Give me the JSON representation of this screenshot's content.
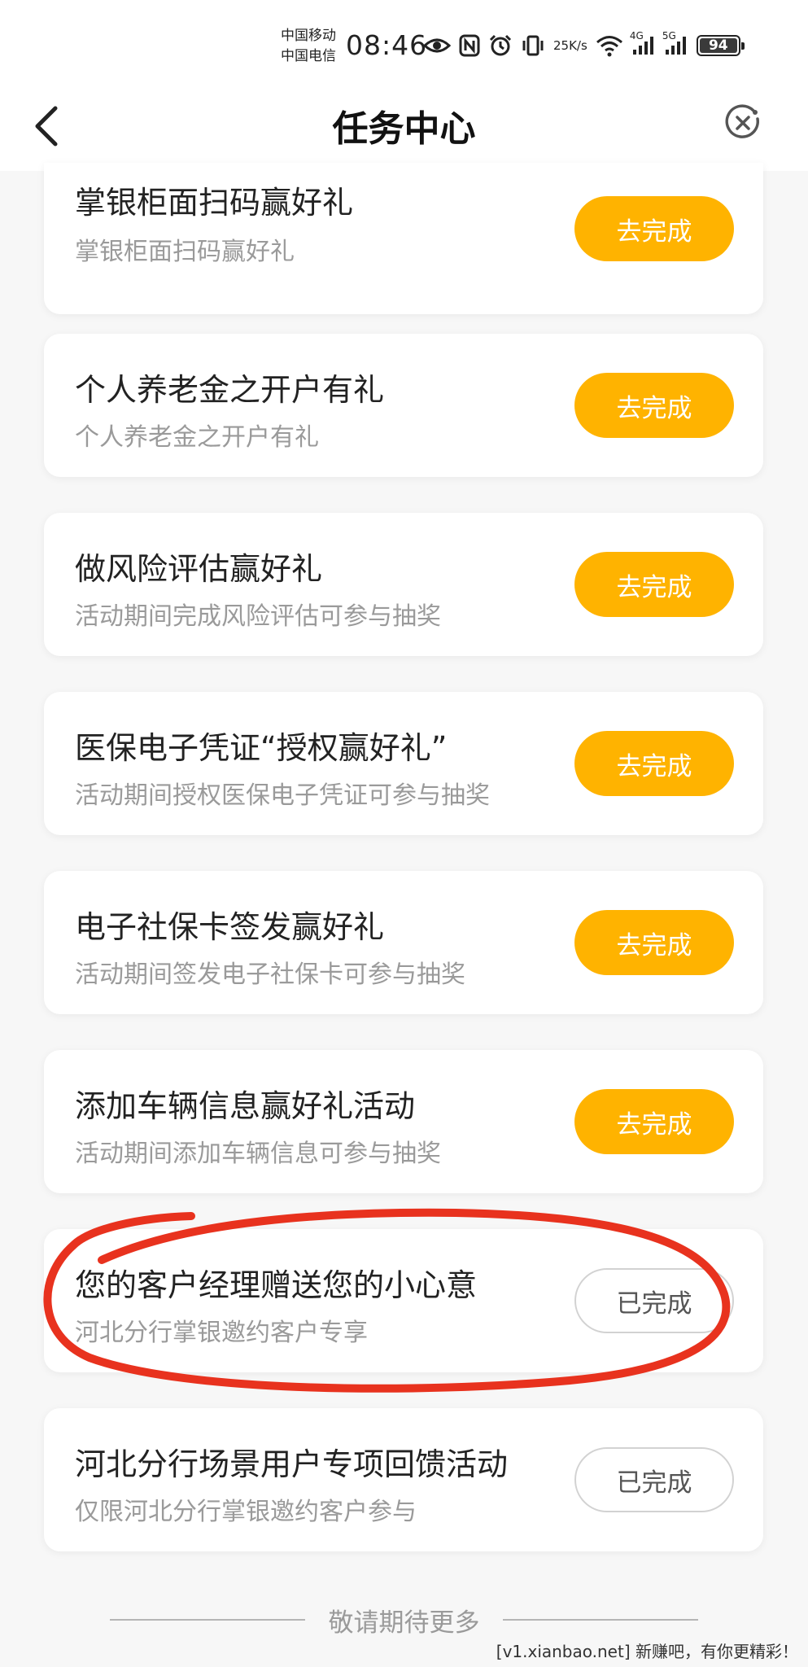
{
  "status_bar": {
    "carrier_1": "中国移动",
    "carrier_2": "中国电信",
    "time": "08:46",
    "speed_value": "25",
    "speed_unit": "K/s",
    "net_1": "4G",
    "net_2": "5G",
    "battery": "94"
  },
  "nav": {
    "title": "任务中心"
  },
  "tasks": [
    {
      "title": "掌银柜面扫码赢好礼",
      "subtitle": "掌银柜面扫码赢好礼",
      "button": "去完成",
      "status": "pending"
    },
    {
      "title": "个人养老金之开户有礼",
      "subtitle": "个人养老金之开户有礼",
      "button": "去完成",
      "status": "pending"
    },
    {
      "title": "做风险评估赢好礼",
      "subtitle": "活动期间完成风险评估可参与抽奖",
      "button": "去完成",
      "status": "pending"
    },
    {
      "title": "医保电子凭证“授权赢好礼”",
      "subtitle": "活动期间授权医保电子凭证可参与抽奖",
      "button": "去完成",
      "status": "pending"
    },
    {
      "title": "电子社保卡签发赢好礼",
      "subtitle": "活动期间签发电子社保卡可参与抽奖",
      "button": "去完成",
      "status": "pending"
    },
    {
      "title": "添加车辆信息赢好礼活动",
      "subtitle": "活动期间添加车辆信息可参与抽奖",
      "button": "去完成",
      "status": "pending"
    },
    {
      "title": "您的客户经理赠送您的小心意",
      "subtitle": "河北分行掌银邀约客户专享",
      "button": "已完成",
      "status": "done"
    },
    {
      "title": "河北分行场景用户专项回馈活动",
      "subtitle": "仅限河北分行掌银邀约客户参与",
      "button": "已完成",
      "status": "done"
    }
  ],
  "footer": {
    "text": "敬请期待更多"
  },
  "watermark": "[v1.xianbao.net] 新赚吧，有你更精彩！",
  "colors": {
    "accent": "#ffb300",
    "annotation": "#e8321e"
  },
  "icons": {
    "back": "chevron-left-icon",
    "close": "close-circle-icon"
  }
}
